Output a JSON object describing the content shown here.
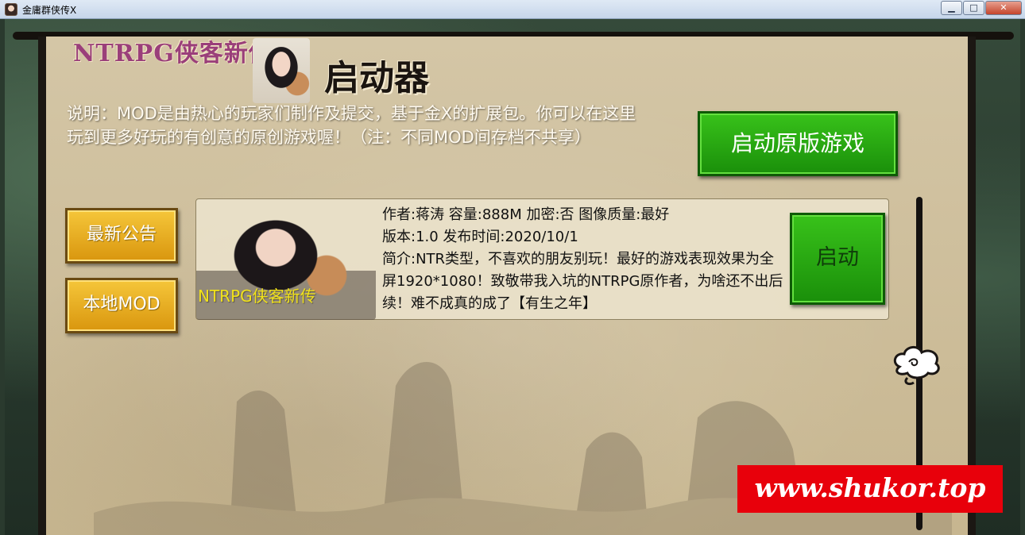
{
  "window": {
    "title": "金庸群侠传X",
    "minimize": "▁",
    "maximize": "□",
    "close": "✕"
  },
  "header": {
    "logo": "NTRPG侠客新传",
    "title": "启动器"
  },
  "description": {
    "line1": "说明：MOD是由热心的玩家们制作及提交，基于金X的扩展包。你可以在这里",
    "line2": "玩到更多好玩的有创意的原创游戏喔！（注：不同MOD间存档不共享）"
  },
  "buttons": {
    "original": "启动原版游戏",
    "news": "最新公告",
    "local_mod": "本地MOD",
    "launch": "启动"
  },
  "mod": {
    "name": "NTRPG侠客新传",
    "meta_line": "作者:蒋涛  容量:888M  加密:否  图像质量:最好",
    "version_line": "版本:1.0  发布时间:2020/10/1",
    "intro": "简介:NTR类型，不喜欢的朋友别玩！最好的游戏表现效果为全屏1920*1080！致敬带我入坑的NTRPG原作者，为啥还不出后续！难不成真的成了【有生之年】"
  },
  "watermark": "www.shukor.top",
  "colors": {
    "green_button": "#2aa812",
    "yellow_button": "#e6a91c",
    "watermark_bg": "#e8000b",
    "mod_name": "#f1e21a"
  }
}
